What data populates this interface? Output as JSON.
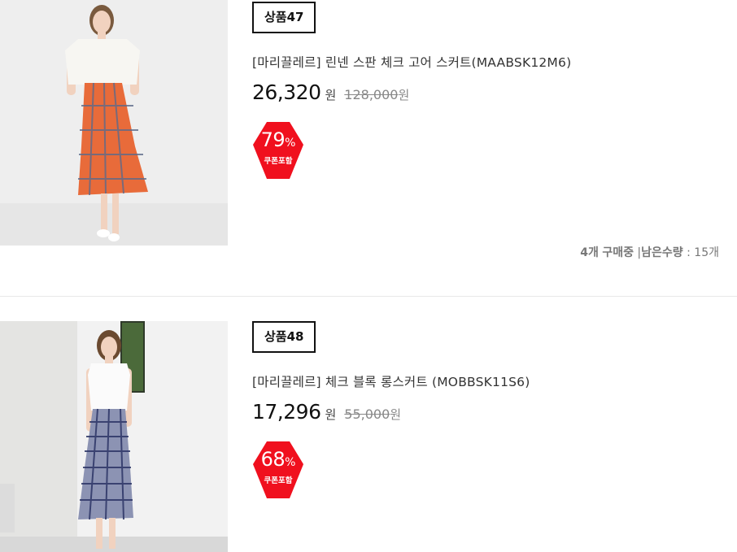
{
  "products": [
    {
      "tag": "상품47",
      "title": "[마리끌레르] 린넨 스판 체크 고어 스커트(MAABSK12M6)",
      "price": "26,320",
      "price_unit": "원",
      "original_price": "128,000",
      "original_unit": "원",
      "discount_number": "79",
      "discount_sign": "%",
      "coupon_label": "쿠폰포함",
      "stock": {
        "buying_count": "4개",
        "buying_label": "구매중",
        "separator": "|",
        "remaining_label": "남은수량",
        "remaining_colon": ":",
        "remaining_value": "15개"
      }
    },
    {
      "tag": "상품48",
      "title": "[마리끌레르] 체크 블록 롱스커트 (MOBBSK11S6)",
      "price": "17,296",
      "price_unit": "원",
      "original_price": "55,000",
      "original_unit": "원",
      "discount_number": "68",
      "discount_sign": "%",
      "coupon_label": "쿠폰포함"
    }
  ],
  "colors": {
    "badge_red": "#f0101e",
    "tag_border": "#111111",
    "divider": "#e9e9e9"
  }
}
